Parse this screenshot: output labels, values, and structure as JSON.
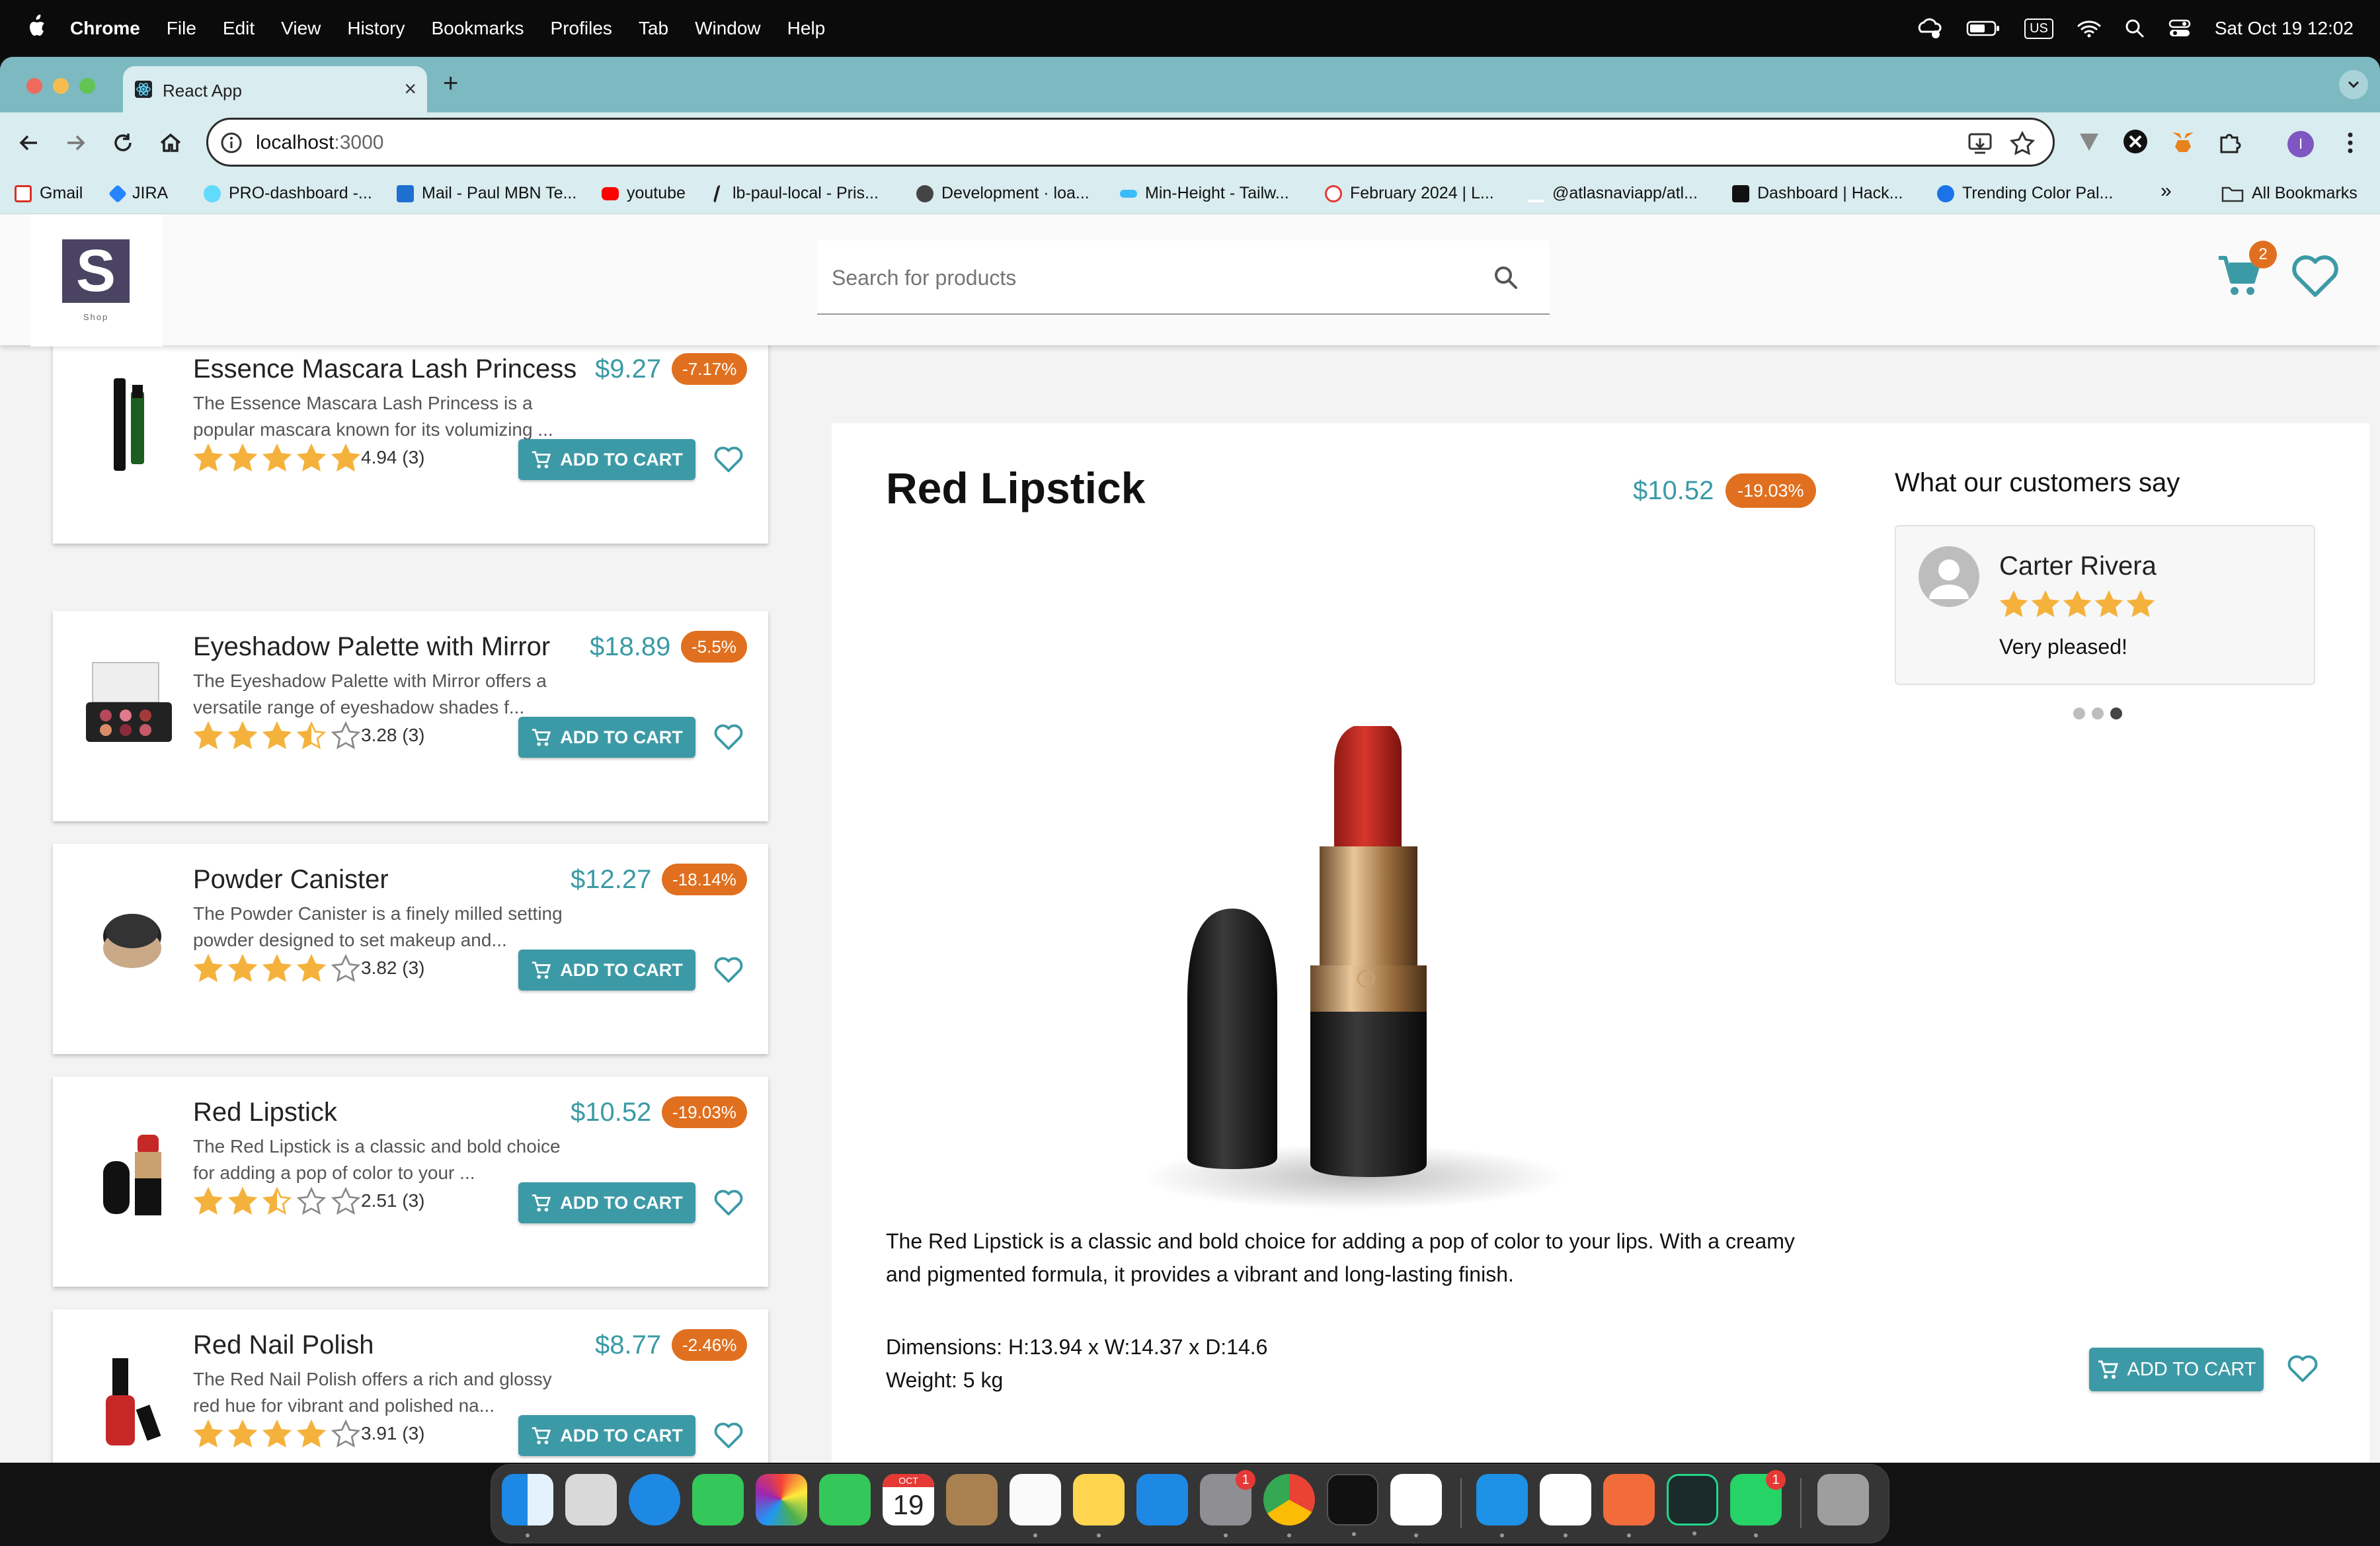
{
  "menubar": {
    "app": "Chrome",
    "items": [
      "File",
      "Edit",
      "View",
      "History",
      "Bookmarks",
      "Profiles",
      "Tab",
      "Window",
      "Help"
    ],
    "input_source": "US",
    "datetime": "Sat Oct 19  12:02"
  },
  "browser": {
    "tab_title": "React App",
    "url_host": "localhost",
    "url_port": ":3000",
    "profile_initial": "I",
    "bookmarks": [
      "Gmail",
      "JIRA",
      "PRO-dashboard -...",
      "Mail - Paul MBN Te...",
      "youtube",
      "lb-paul-local - Pris...",
      "Development · loa...",
      "Min-Height - Tailw...",
      "February 2024 | L...",
      "@atlasnaviapp/atl...",
      "Dashboard | Hack...",
      "Trending Color Pal..."
    ],
    "bookmarks_overflow": "»",
    "all_bookmarks": "All Bookmarks"
  },
  "header": {
    "logo_letter": "S",
    "logo_sub": "Shop",
    "search_placeholder": "Search for products",
    "cart_count": "2"
  },
  "products": [
    {
      "name": "Essence Mascara Lash Princess",
      "price": "$9.27",
      "discount": "-7.17%",
      "desc_line1": "The Essence Mascara Lash Princess is a",
      "desc_line2": "popular mascara known for its volumizing ...",
      "rating_text": "4.94 (3)",
      "rating": 4.94,
      "add_label": "ADD TO CART"
    },
    {
      "name": "Eyeshadow Palette with Mirror",
      "price": "$18.89",
      "discount": "-5.5%",
      "desc_line1": "The Eyeshadow Palette with Mirror offers a",
      "desc_line2": "versatile range of eyeshadow shades f...",
      "rating_text": "3.28 (3)",
      "rating": 3.28,
      "add_label": "ADD TO CART"
    },
    {
      "name": "Powder Canister",
      "price": "$12.27",
      "discount": "-18.14%",
      "desc_line1": "The Powder Canister is a finely milled setting",
      "desc_line2": "powder designed to set makeup and...",
      "rating_text": "3.82 (3)",
      "rating": 3.82,
      "add_label": "ADD TO CART"
    },
    {
      "name": "Red Lipstick",
      "price": "$10.52",
      "discount": "-19.03%",
      "desc_line1": "The Red Lipstick is a classic and bold choice",
      "desc_line2": "for adding a pop of color to your ...",
      "rating_text": "2.51 (3)",
      "rating": 2.51,
      "add_label": "ADD TO CART"
    },
    {
      "name": "Red Nail Polish",
      "price": "$8.77",
      "discount": "-2.46%",
      "desc_line1": "The Red Nail Polish offers a rich and glossy",
      "desc_line2": "red hue for vibrant and polished na...",
      "rating_text": "3.91 (3)",
      "rating": 3.91,
      "add_label": "ADD TO CART"
    }
  ],
  "detail": {
    "title": "Red Lipstick",
    "price": "$10.52",
    "discount": "-19.03%",
    "desc_line1": "The Red Lipstick is a classic and bold choice for adding a pop of color to your lips. With a creamy",
    "desc_line2": "and pigmented formula, it provides a vibrant and long-lasting finish.",
    "dimensions": "Dimensions: H:13.94 x W:14.37 x D:14.6",
    "weight": "Weight: 5 kg",
    "add_label": "ADD TO CART"
  },
  "reviews": {
    "title": "What our customers say",
    "reviewer": "Carter Rivera",
    "stars": 5,
    "comment": "Very pleased!",
    "dots": 3,
    "active_dot": 3
  },
  "dock": {
    "calendar_month": "OCT",
    "calendar_day": "19",
    "settings_badge": "1",
    "whatsapp_badge": "1"
  },
  "colors": {
    "accent": "#3c9aa6",
    "discount": "#e0701f",
    "star": "#f4b23c",
    "tabstrip": "#7cb9c1",
    "toolbar": "#d9ecef"
  }
}
